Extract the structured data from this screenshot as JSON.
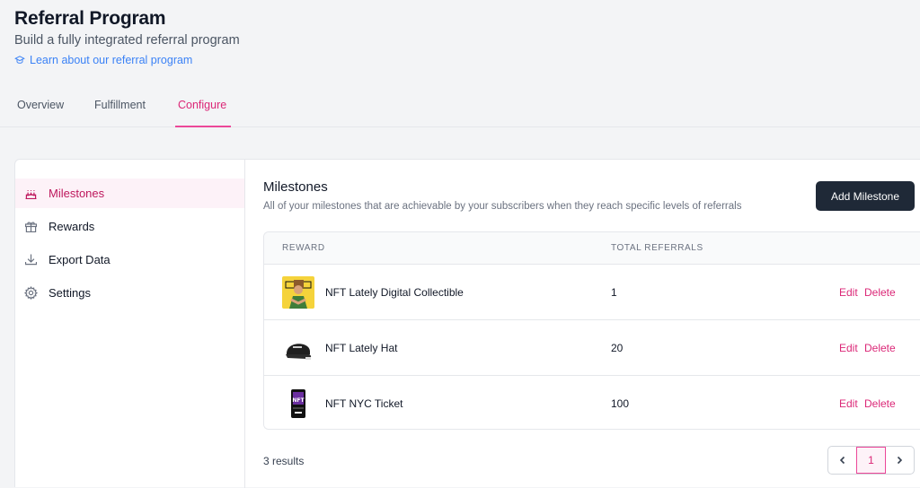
{
  "header": {
    "title": "Referral Program",
    "subtitle": "Build a fully integrated referral program",
    "learn_link": "Learn about our referral program",
    "learn_icon": "academic-cap-icon"
  },
  "tabs": [
    {
      "label": "Overview",
      "active": false
    },
    {
      "label": "Fulfillment",
      "active": false
    },
    {
      "label": "Configure",
      "active": true
    }
  ],
  "sidebar": {
    "items": [
      {
        "label": "Milestones",
        "icon": "cake-icon",
        "active": true
      },
      {
        "label": "Rewards",
        "icon": "gift-icon",
        "active": false
      },
      {
        "label": "Export Data",
        "icon": "download-icon",
        "active": false
      },
      {
        "label": "Settings",
        "icon": "gear-icon",
        "active": false
      }
    ]
  },
  "main": {
    "title": "Milestones",
    "description": "All of your milestones that are achievable by your subscribers when they reach specific levels of referrals",
    "add_button": "Add Milestone",
    "columns": {
      "reward": "Reward",
      "total_referrals": "Total Referrals"
    },
    "rows": [
      {
        "reward": "NFT Lately Digital Collectible",
        "total_referrals": "1",
        "edit": "Edit",
        "delete": "Delete"
      },
      {
        "reward": "NFT Lately Hat",
        "total_referrals": "20",
        "edit": "Edit",
        "delete": "Delete"
      },
      {
        "reward": "NFT NYC Ticket",
        "total_referrals": "100",
        "edit": "Edit",
        "delete": "Delete"
      }
    ],
    "results": "3 results",
    "pagination": {
      "current_page": "1"
    }
  },
  "colors": {
    "accent": "#db2777",
    "primary_button": "#1f2937",
    "link": "#3b82f6"
  }
}
